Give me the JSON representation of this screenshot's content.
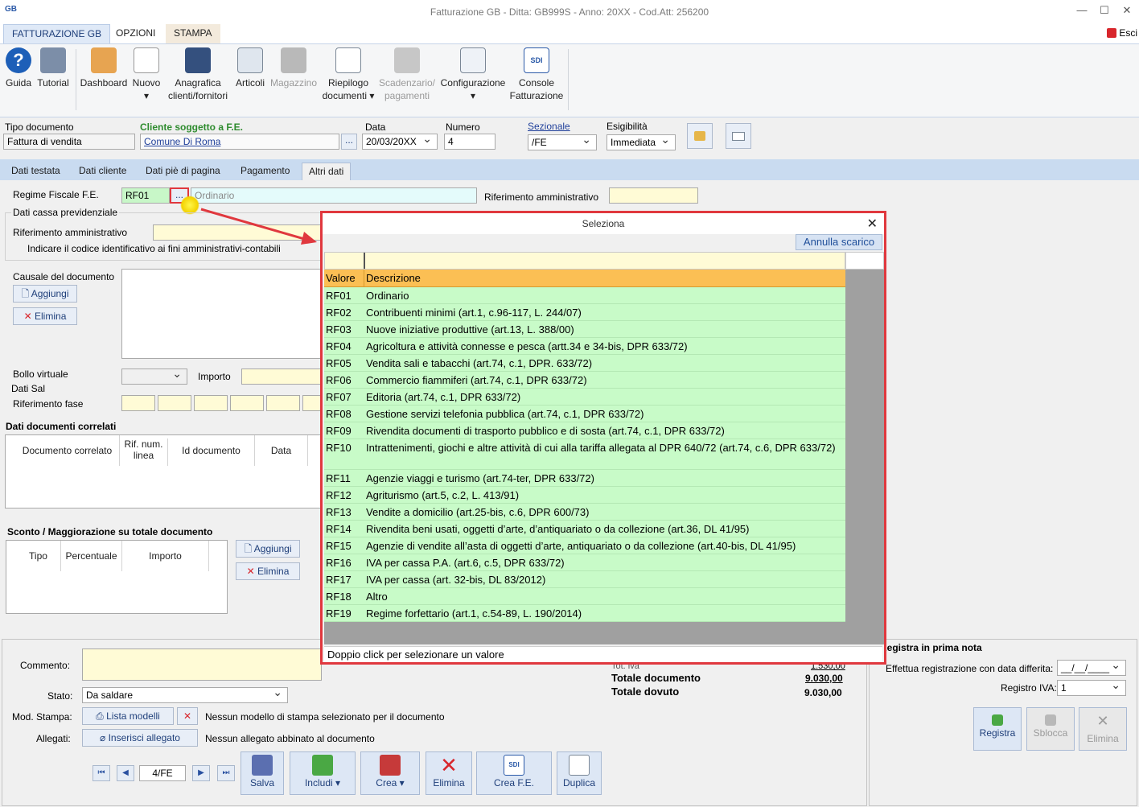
{
  "window": {
    "title": "Fatturazione GB - Ditta: GB999S - Anno: 20XX - Cod.Att: 256200",
    "exit": "Esci"
  },
  "ribbon_tabs": [
    "FATTURAZIONE GB",
    "OPZIONI",
    "STAMPA"
  ],
  "ribbon": {
    "guida": "Guida",
    "tutorial": "Tutorial",
    "dashboard": "Dashboard",
    "nuovo": "Nuovo",
    "anagrafica1": "Anagrafica",
    "anagrafica2": "clienti/fornitori",
    "articoli": "Articoli",
    "magazzino": "Magazzino",
    "riepilogo1": "Riepilogo",
    "riepilogo2": "documenti",
    "scad1": "Scadenzario/",
    "scad2": "pagamenti",
    "config": "Configurazione",
    "console1": "Console",
    "console2": "Fatturazione",
    "sdi": "SDI"
  },
  "header": {
    "tipo_label": "Tipo documento",
    "tipo_value": "Fattura di vendita",
    "cliente_label": "Cliente soggetto a F.E.",
    "cliente_value": "Comune Di Roma",
    "data_label": "Data",
    "data_value": "20/03/20XX",
    "numero_label": "Numero",
    "numero_value": "4",
    "sezionale_label": "Sezionale",
    "sezionale_value": "/FE",
    "esig_label": "Esigibilità",
    "esig_value": "Immediata",
    "dots": "..."
  },
  "tabs": [
    "Dati testata",
    "Dati cliente",
    "Dati piè di pagina",
    "Pagamento",
    "Altri dati"
  ],
  "altri": {
    "regime_label": "Regime Fiscale F.E.",
    "regime_value": "RF01",
    "regime_desc": "Ordinario",
    "rif_amm_label": "Riferimento amministrativo",
    "cassa_title": "Dati cassa previdenziale",
    "rif_amm2_label": "Riferimento amministrativo",
    "rif_amm_hint": "Indicare il codice identificativo ai fini amministrativi-contabili",
    "causale_label": "Causale del documento",
    "aggiungi": "Aggiungi",
    "elimina": "Elimina",
    "bollo_label": "Bollo virtuale",
    "importo_label": "Importo",
    "sal_title": "Dati Sal",
    "rif_fase_label": "Riferimento fase"
  },
  "correlati": {
    "title": "Dati documenti correlati",
    "cols": [
      "Documento correlato",
      "Rif. num. linea",
      "Id documento",
      "Data"
    ]
  },
  "sconto": {
    "title": "Sconto / Maggiorazione su totale documento",
    "cols": [
      "Tipo",
      "Percentuale",
      "Importo"
    ],
    "aggiungi": "Aggiungi",
    "elimina": "Elimina"
  },
  "footer": {
    "commento_label": "Commento:",
    "stato_label": "Stato:",
    "stato_value": "Da saldare",
    "mod_label": "Mod. Stampa:",
    "lista": "Lista modelli",
    "nessun_modello": "Nessun modello di stampa selezionato per il documento",
    "allegati_label": "Allegati:",
    "inserisci": "Inserisci allegato",
    "nessun_allegato": "Nessun allegato abbinato al documento",
    "doc_counter": "4/FE",
    "salva": "Salva",
    "includi": "Includi",
    "crea": "Crea",
    "elimina": "Elimina",
    "crea_fe": "Crea F.E.",
    "duplica": "Duplica"
  },
  "totals": {
    "tot_iva_label": "Tot. iva",
    "tot_iva_value": "1.530,00",
    "tot_doc_label": "Totale documento",
    "tot_doc_value": "9.030,00",
    "tot_dov_label": "Totale dovuto",
    "tot_dov_value": "9.030,00"
  },
  "prima_nota": {
    "title": "Registra in prima nota",
    "differita_label": "Effettua registrazione con data differita:",
    "differita_value": "__/__/____",
    "registro_label": "Registro IVA:",
    "registro_value": "1",
    "registra": "Registra",
    "sblocca": "Sblocca",
    "elimina": "Elimina"
  },
  "dialog": {
    "title": "Seleziona",
    "annulla": "Annulla scarico",
    "col_valore": "Valore",
    "col_descrizione": "Descrizione",
    "status": "Doppio click per selezionare un valore",
    "rows": [
      {
        "v": "RF01",
        "d": "Ordinario"
      },
      {
        "v": "RF02",
        "d": "Contribuenti minimi (art.1, c.96-117, L. 244/07)"
      },
      {
        "v": "RF03",
        "d": "Nuove iniziative produttive (art.13, L. 388/00)"
      },
      {
        "v": "RF04",
        "d": "Agricoltura e attività connesse e pesca (artt.34 e 34-bis, DPR 633/72)"
      },
      {
        "v": "RF05",
        "d": "Vendita sali e tabacchi (art.74, c.1, DPR. 633/72)"
      },
      {
        "v": "RF06",
        "d": "Commercio fiammiferi (art.74, c.1, DPR  633/72)"
      },
      {
        "v": "RF07",
        "d": "Editoria (art.74, c.1, DPR  633/72)"
      },
      {
        "v": "RF08",
        "d": "Gestione servizi telefonia pubblica (art.74, c.1, DPR 633/72)"
      },
      {
        "v": "RF09",
        "d": "Rivendita documenti di trasporto pubblico e di sosta (art.74, c.1, DPR  633/72)"
      },
      {
        "v": "RF10",
        "d": "Intrattenimenti, giochi e altre attività di cui alla tariffa allegata al DPR 640/72 (art.74, c.6, DPR 633/72)"
      },
      {
        "v": "RF11",
        "d": "Agenzie viaggi e turismo (art.74-ter, DPR 633/72)"
      },
      {
        "v": "RF12",
        "d": "Agriturismo (art.5, c.2, L. 413/91)"
      },
      {
        "v": "RF13",
        "d": "Vendite a domicilio (art.25-bis, c.6, DPR  600/73)"
      },
      {
        "v": "RF14",
        "d": "Rivendita beni usati, oggetti d’arte, d’antiquariato o da collezione (art.36, DL 41/95)"
      },
      {
        "v": "RF15",
        "d": "Agenzie di vendite all’asta di oggetti d’arte, antiquariato o da collezione (art.40-bis, DL 41/95)"
      },
      {
        "v": "RF16",
        "d": "IVA per cassa P.A. (art.6, c.5, DPR 633/72)"
      },
      {
        "v": "RF17",
        "d": "IVA per cassa (art. 32-bis, DL 83/2012)"
      },
      {
        "v": "RF18",
        "d": "Altro"
      },
      {
        "v": "RF19",
        "d": "Regime forfettario (art.1, c.54-89, L. 190/2014)"
      }
    ]
  }
}
